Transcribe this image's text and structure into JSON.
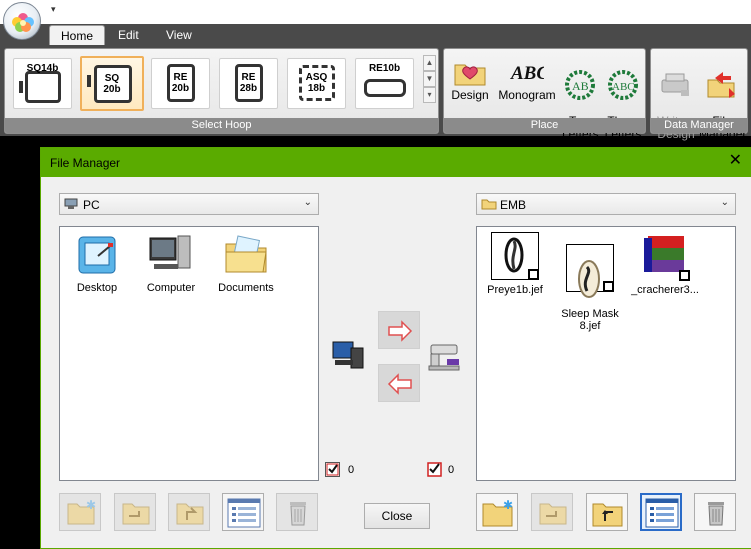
{
  "tabs": [
    {
      "label": "Home",
      "active": true
    },
    {
      "label": "Edit",
      "active": false
    },
    {
      "label": "View",
      "active": false
    }
  ],
  "ribbon": {
    "select_hoop": {
      "label": "Select Hoop",
      "hoops": [
        {
          "label": "SQ14b",
          "selected": false
        },
        {
          "label": "SQ\n20b",
          "selected": true
        },
        {
          "label": "RE\n20b",
          "selected": false
        },
        {
          "label": "RE\n28b",
          "selected": false
        },
        {
          "label": "ASQ\n18b",
          "selected": false
        },
        {
          "label": "RE10b",
          "selected": false
        }
      ]
    },
    "place": {
      "label": "Place",
      "buttons": [
        {
          "label": "Design",
          "icon": "design-heart-folder-icon"
        },
        {
          "label": "Monogram",
          "icon": "monogram-abc-icon"
        },
        {
          "label": "Two\nLetters",
          "icon": "two-letters-wreath-icon"
        },
        {
          "label": "Three\nLetters",
          "icon": "three-letters-wreath-icon"
        }
      ]
    },
    "data_manager": {
      "label": "Data Manager",
      "buttons": [
        {
          "label": "Write a\nDesign",
          "icon": "write-design-icon",
          "disabled": true
        },
        {
          "label": "File\nManager",
          "icon": "file-manager-icon",
          "disabled": false
        }
      ]
    }
  },
  "file_manager": {
    "title": "File Manager",
    "left": {
      "location": "PC",
      "items": [
        {
          "label": "Desktop",
          "icon": "desktop-icon"
        },
        {
          "label": "Computer",
          "icon": "computer-icon"
        },
        {
          "label": "Documents",
          "icon": "documents-folder-icon"
        }
      ],
      "count": "0"
    },
    "right": {
      "location": "EMB",
      "items": [
        {
          "label": "Preye1b.jef"
        },
        {
          "label": "Sleep Mask\n8.jef"
        },
        {
          "label": "_cracherer3..."
        }
      ],
      "count": "0"
    },
    "close_label": "Close"
  },
  "colors": {
    "title_bar": "#5aab00",
    "ribbon_bg": "#4a4a4a",
    "selected_hoop": "#f0b05a"
  }
}
